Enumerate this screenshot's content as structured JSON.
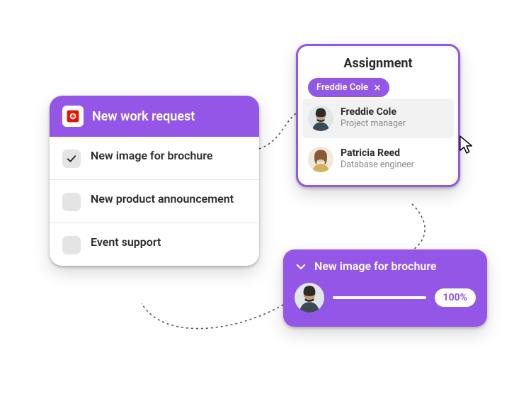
{
  "colors": {
    "accent": "#9356e6",
    "label": "#2b2b2b",
    "muted": "#8a8a8a",
    "chk_bg": "#e4e4e4"
  },
  "work_request": {
    "title": "New work request",
    "app_icon": "lion-icon",
    "items": [
      {
        "label": "New image for brochure",
        "checked": true
      },
      {
        "label": "New product announcement",
        "checked": false
      },
      {
        "label": "Event support",
        "checked": false
      }
    ]
  },
  "assignment": {
    "title": "Assignment",
    "chip": {
      "label": "Freddie Cole",
      "dismiss_glyph": "✕"
    },
    "people": [
      {
        "name": "Freddie Cole",
        "role": "Project manager",
        "hovered": true
      },
      {
        "name": "Patricia Reed",
        "role": "Database engineer",
        "hovered": false
      }
    ]
  },
  "progress": {
    "title": "New image for brochure",
    "percent_label": "100%",
    "percent_value": 100
  }
}
